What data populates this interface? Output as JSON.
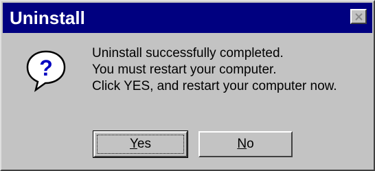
{
  "dialog": {
    "title": "Uninstall",
    "icon": "question-icon",
    "message_lines": [
      "Uninstall successfully completed.",
      "You must restart your computer.",
      "Click YES, and restart your computer now."
    ],
    "buttons": {
      "yes": {
        "mnemonic": "Y",
        "rest": "es"
      },
      "no": {
        "mnemonic": "N",
        "rest": "o"
      }
    }
  },
  "colors": {
    "titlebar": "#000080",
    "face": "#c3c3c3",
    "icon_fill": "#0000c0"
  }
}
